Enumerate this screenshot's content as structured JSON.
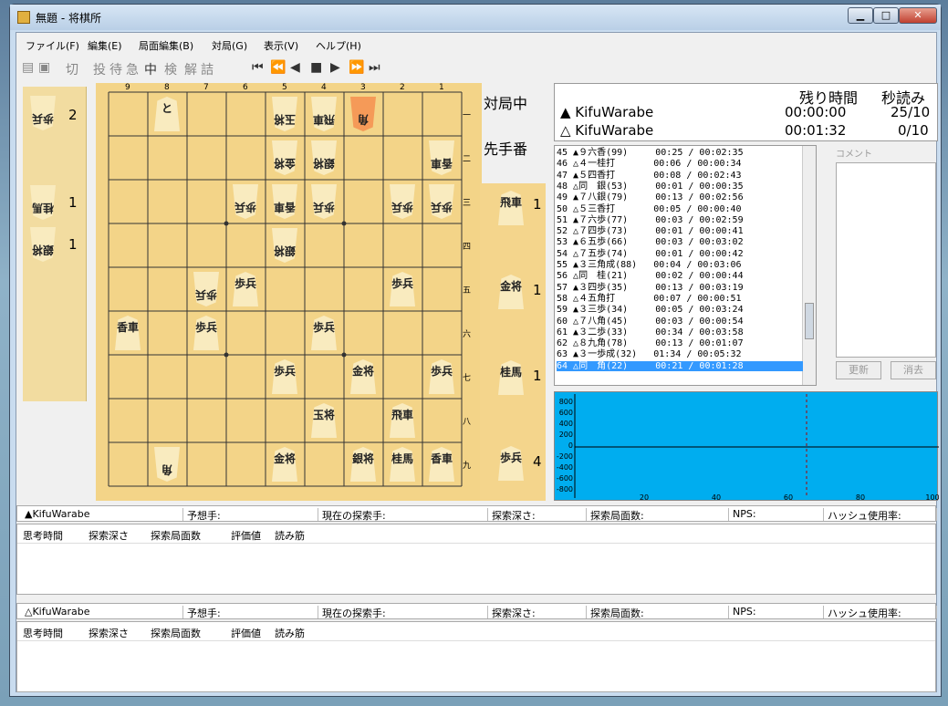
{
  "window": {
    "title": "無題 - 将棋所",
    "min": "▁",
    "max": "□",
    "close": "✕"
  },
  "menu": [
    "ファイル(F)",
    "編集(E)",
    "局面編集(B)",
    "対局(G)",
    "表示(V)",
    "ヘルプ(H)"
  ],
  "toolbar": [
    "切",
    "投",
    "待",
    "急",
    "中",
    "検",
    "解",
    "詰",
    "⏮",
    "⏪",
    "◀",
    "■",
    "▶",
    "⏩",
    "⏭"
  ],
  "board": {
    "files": [
      "9",
      "8",
      "7",
      "6",
      "5",
      "4",
      "3",
      "2",
      "1"
    ],
    "ranks": [
      "一",
      "二",
      "三",
      "四",
      "五",
      "六",
      "七",
      "八",
      "九"
    ],
    "pieces": [
      {
        "f": 8,
        "r": 1,
        "k": "と",
        "rev": false
      },
      {
        "f": 5,
        "r": 1,
        "k": "玉将",
        "rev": true
      },
      {
        "f": 4,
        "r": 1,
        "k": "飛車",
        "rev": true
      },
      {
        "f": 3,
        "r": 1,
        "k": "角",
        "rev": true,
        "last": true
      },
      {
        "f": 5,
        "r": 2,
        "k": "金将",
        "rev": true
      },
      {
        "f": 4,
        "r": 2,
        "k": "銀将",
        "rev": true
      },
      {
        "f": 1,
        "r": 2,
        "k": "香車",
        "rev": true
      },
      {
        "f": 6,
        "r": 3,
        "k": "歩兵",
        "rev": true
      },
      {
        "f": 5,
        "r": 3,
        "k": "香車",
        "rev": true
      },
      {
        "f": 4,
        "r": 3,
        "k": "歩兵",
        "rev": true
      },
      {
        "f": 2,
        "r": 3,
        "k": "歩兵",
        "rev": true
      },
      {
        "f": 1,
        "r": 3,
        "k": "歩兵",
        "rev": true
      },
      {
        "f": 5,
        "r": 4,
        "k": "銀将",
        "rev": true
      },
      {
        "f": 7,
        "r": 5,
        "k": "歩兵",
        "rev": true
      },
      {
        "f": 6,
        "r": 5,
        "k": "歩兵",
        "rev": false
      },
      {
        "f": 2,
        "r": 5,
        "k": "歩兵",
        "rev": false
      },
      {
        "f": 9,
        "r": 6,
        "k": "香車",
        "rev": false
      },
      {
        "f": 7,
        "r": 6,
        "k": "歩兵",
        "rev": false
      },
      {
        "f": 4,
        "r": 6,
        "k": "歩兵",
        "rev": false
      },
      {
        "f": 5,
        "r": 7,
        "k": "歩兵",
        "rev": false
      },
      {
        "f": 3,
        "r": 7,
        "k": "金将",
        "rev": false
      },
      {
        "f": 1,
        "r": 7,
        "k": "歩兵",
        "rev": false
      },
      {
        "f": 4,
        "r": 8,
        "k": "玉将",
        "rev": false
      },
      {
        "f": 2,
        "r": 8,
        "k": "飛車",
        "rev": false
      },
      {
        "f": 8,
        "r": 9,
        "k": "角",
        "rev": true
      },
      {
        "f": 5,
        "r": 9,
        "k": "金将",
        "rev": false
      },
      {
        "f": 3,
        "r": 9,
        "k": "銀将",
        "rev": false
      },
      {
        "f": 2,
        "r": 9,
        "k": "桂馬",
        "rev": false
      },
      {
        "f": 1,
        "r": 9,
        "k": "香車",
        "rev": false
      }
    ]
  },
  "gote_hand": [
    {
      "k": "歩兵",
      "n": "2"
    },
    {
      "k": "桂馬",
      "n": "1"
    },
    {
      "k": "銀将",
      "n": "1"
    }
  ],
  "sente_hand": [
    {
      "k": "飛車",
      "n": "1"
    },
    {
      "k": "金将",
      "n": "1"
    },
    {
      "k": "桂馬",
      "n": "1"
    },
    {
      "k": "歩兵",
      "n": "4"
    }
  ],
  "status": {
    "line1": "対局中",
    "line2": "先手番"
  },
  "clock": {
    "h_remain": "残り時間",
    "h_byoyomi": "秒読み",
    "p1": "▲ KifuWarabe",
    "p1_time": "00:00:00",
    "p1_byo": "25/10",
    "p2": "△ KifuWarabe",
    "p2_time": "00:01:32",
    "p2_byo": "0/10"
  },
  "kifu": [
    "45 ▲９六香(99)     00:25 / 00:02:35",
    "46 △４一桂打       00:06 / 00:00:34",
    "47 ▲５四香打       00:08 / 00:02:43",
    "48 △同　銀(53)     00:01 / 00:00:35",
    "49 ▲７八銀(79)     00:13 / 00:02:56",
    "50 △５三香打       00:05 / 00:00:40",
    "51 ▲７六歩(77)     00:03 / 00:02:59",
    "52 △７四歩(73)     00:01 / 00:00:41",
    "53 ▲６五歩(66)     00:03 / 00:03:02",
    "54 △７五歩(74)     00:01 / 00:00:42",
    "55 ▲３三角成(88)   00:04 / 00:03:06",
    "56 △同　桂(21)     00:02 / 00:00:44",
    "57 ▲３四歩(35)     00:13 / 00:03:19",
    "58 △４五角打       00:07 / 00:00:51",
    "59 ▲３三歩(34)     00:05 / 00:03:24",
    "60 △７八角(45)     00:03 / 00:00:54",
    "61 ▲３二歩(33)     00:34 / 00:03:58",
    "62 △８九角(78)     00:13 / 00:01:07",
    "63 ▲３一歩成(32)   01:34 / 00:05:32",
    "64 △同　角(22)     00:21 / 00:01:28"
  ],
  "comment": {
    "label": "コメント",
    "update": "更新",
    "clear": "消去"
  },
  "graph": {
    "yticks": [
      "800",
      "600",
      "400",
      "200",
      "0",
      "-200",
      "-400",
      "-600",
      "-800"
    ],
    "xticks": [
      "20",
      "40",
      "60",
      "80",
      "100"
    ]
  },
  "think": [
    {
      "player": "▲KifuWarabe",
      "pred": "予想手:",
      "cur": "現在の探索手:",
      "depth": "探索深さ:",
      "nodes": "探索局面数:",
      "nps": "NPS:",
      "hash": "ハッシュ使用率:"
    },
    {
      "player": "△KifuWarabe",
      "pred": "予想手:",
      "cur": "現在の探索手:",
      "depth": "探索深さ:",
      "nodes": "探索局面数:",
      "nps": "NPS:",
      "hash": "ハッシュ使用率:"
    }
  ],
  "think_cols": [
    "思考時間",
    "探索深さ",
    "探索局面数",
    "評価値",
    "読み筋"
  ]
}
